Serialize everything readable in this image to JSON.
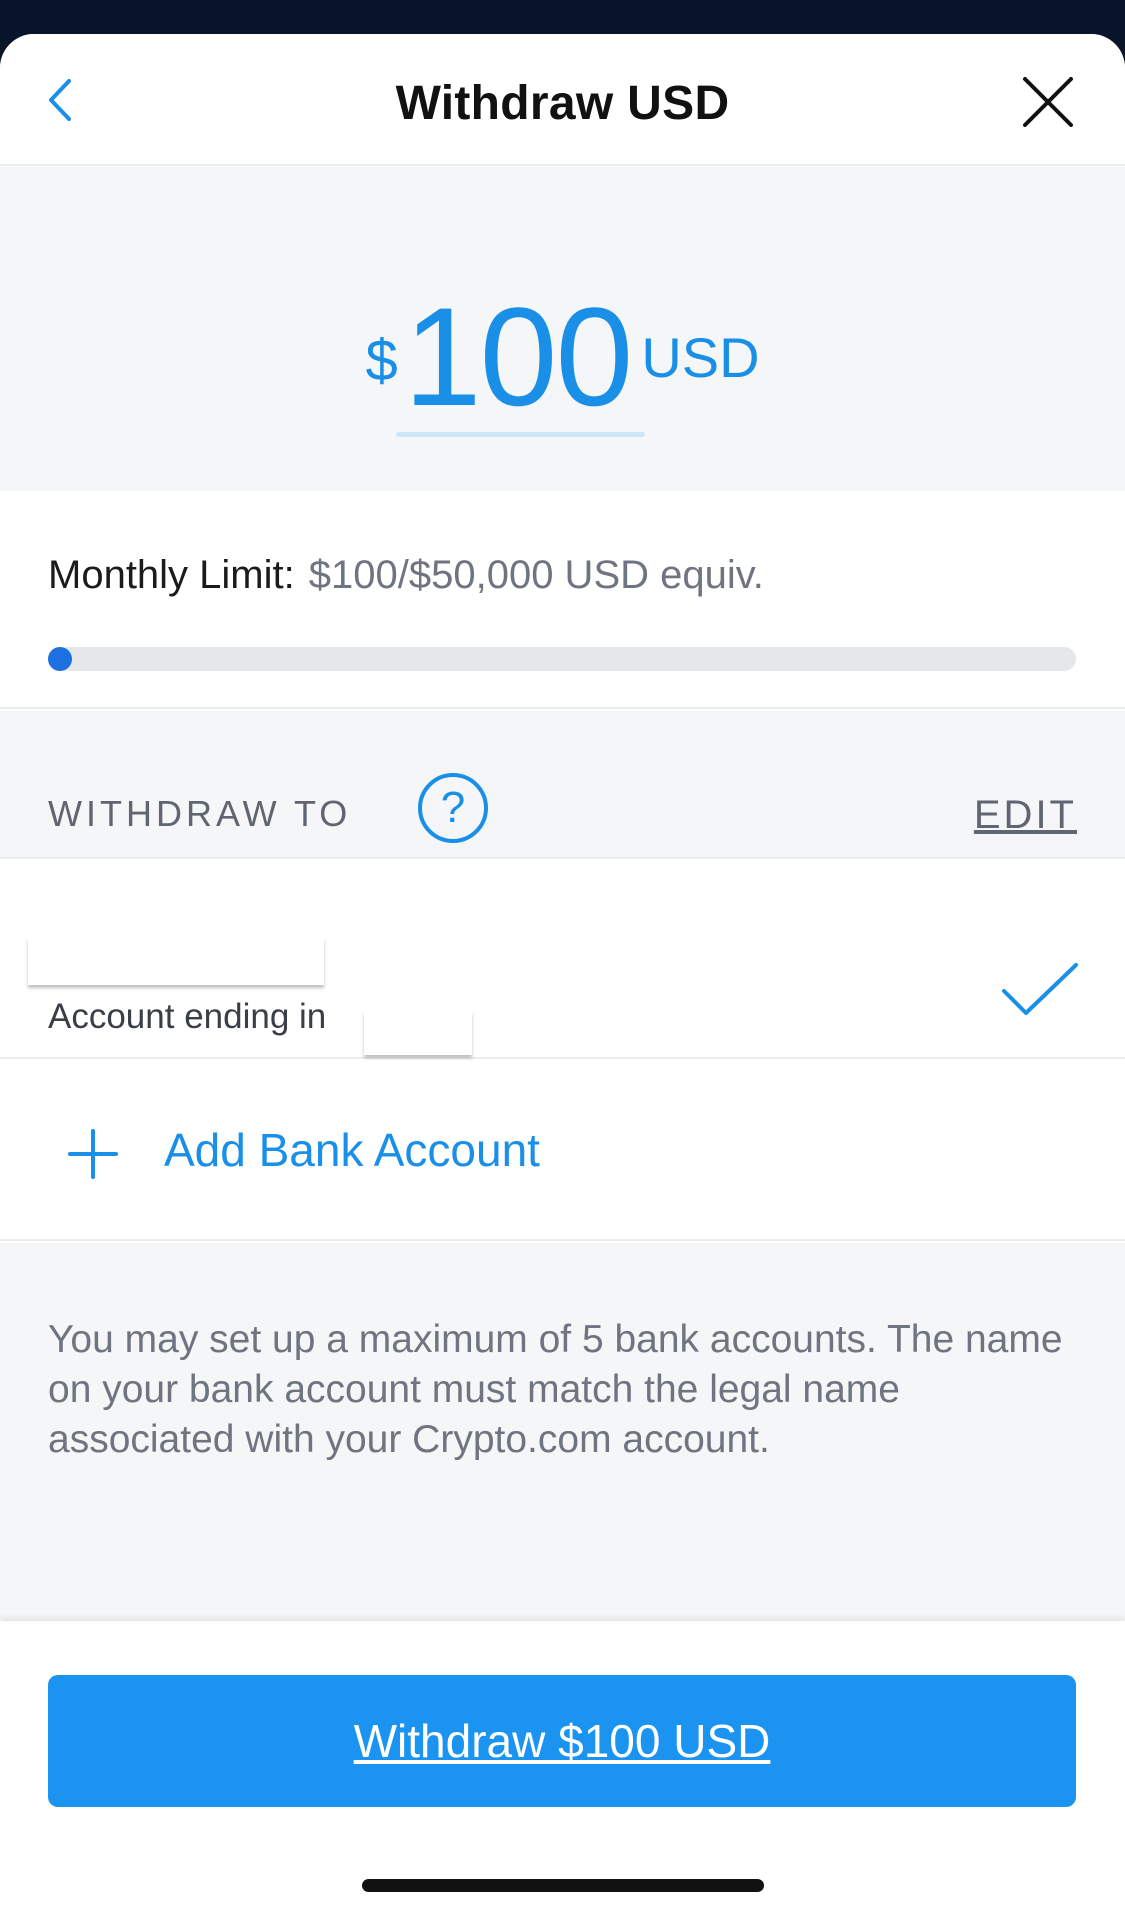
{
  "header": {
    "title": "Withdraw USD",
    "back_icon": "chevron-left-icon",
    "close_icon": "close-icon"
  },
  "amount": {
    "currency_symbol": "$",
    "value": "100",
    "unit": "USD"
  },
  "limit": {
    "label": "Monthly Limit:",
    "value": "$100/$50,000 USD equiv.",
    "progress_fraction": 0.002
  },
  "withdraw_to": {
    "label": "WITHDRAW TO",
    "help_label": "?",
    "edit_label": "EDIT"
  },
  "account": {
    "subtitle": "Account ending in",
    "selected": true
  },
  "add_account": {
    "label": "Add Bank Account"
  },
  "info": {
    "text": "You may set up a maximum of 5 bank accounts. The name on your bank account must match the legal name associated with your Crypto.com account."
  },
  "cta": {
    "label": "Withdraw $100 USD"
  },
  "colors": {
    "accent": "#1a8fe8",
    "button": "#1a94f0",
    "progress": "#1e6fe0"
  }
}
